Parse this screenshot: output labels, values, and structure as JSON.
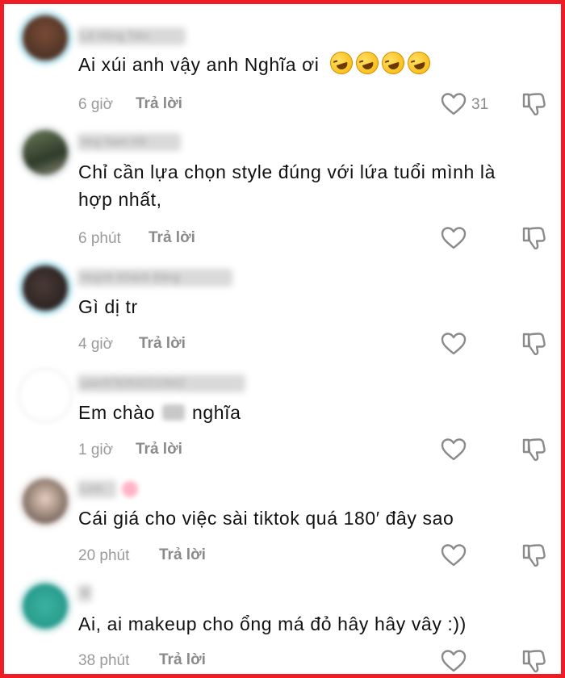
{
  "comments": [
    {
      "username": "Lê Hồng Tiên",
      "text": "Ai xúi anh vậy anh Nghĩa ơi",
      "emoji": [
        "rolling-on-floor-laughing",
        "rolling-on-floor-laughing",
        "rolling-on-floor-laughing",
        "rolling-on-floor-laughing"
      ],
      "time": "6 giờ",
      "reply": "Trả lời",
      "likes": "31"
    },
    {
      "username": "Huy Nam Hồ",
      "text_line1": "Chỉ cần lựa chọn style đúng với lứa tuổi mình là",
      "text_line2": "hợp nhất,",
      "time": "6 phút",
      "reply": "Trả lời",
      "likes": ""
    },
    {
      "username": "Huỳnh Khánh Băng",
      "text": "Gì dị tr",
      "time": "4 giờ",
      "reply": "Trả lời",
      "likes": ""
    },
    {
      "username": "user9782632210842",
      "text_before": "Em chào",
      "text_after": "nghĩa",
      "time": "1 giờ",
      "reply": "Trả lời",
      "likes": ""
    },
    {
      "username": "Linh",
      "text": "Cái giá cho việc sài tiktok quá 180′ đây sao",
      "time": "20 phút",
      "reply": "Trả lời",
      "likes": ""
    },
    {
      "username": "lil",
      "text": "Ai, ai makeup cho ổng má đỏ hây hây vây :))",
      "time": "38 phút",
      "reply": "Trả lời",
      "likes": ""
    }
  ],
  "colors": {
    "frame_border": "#ee1c24",
    "text": "#111111",
    "meta": "#9a9a9a",
    "icon": "#8a8a8a"
  },
  "icons": {
    "like": "heart-outline-icon",
    "dislike": "thumbs-down-outline-icon"
  }
}
